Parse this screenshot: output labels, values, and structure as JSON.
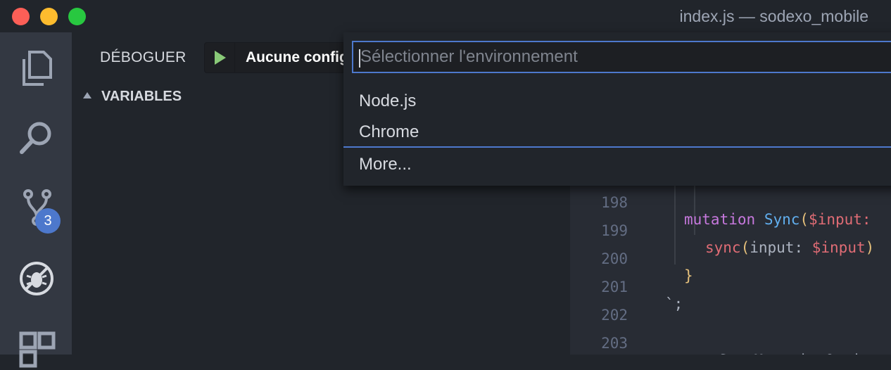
{
  "window": {
    "title": "index.js — sodexo_mobile"
  },
  "activity_bar": {
    "items": [
      {
        "icon": "files-icon"
      },
      {
        "icon": "search-icon"
      },
      {
        "icon": "source-control-icon",
        "badge": "3"
      },
      {
        "icon": "debug-icon"
      },
      {
        "icon": "extensions-icon"
      }
    ]
  },
  "debug": {
    "section_label": "DÉBOGUER",
    "config_name": "Aucune config",
    "variables_label": "VARIABLES"
  },
  "quick_pick": {
    "placeholder": "Sélectionner l'environnement",
    "options": [
      "Node.js",
      "Chrome"
    ],
    "more_label": "More..."
  },
  "editor": {
    "lines": [
      {
        "number": "198",
        "text": "mutation Sync($input:"
      },
      {
        "number": "199",
        "text": "sync(input: $input)"
      },
      {
        "number": "200",
        "text": "}"
      },
      {
        "number": "201",
        "text": "`;"
      },
      {
        "number": "202",
        "text": ""
      },
      {
        "number": "203",
        "text": "const SyncMutationOptio"
      }
    ]
  },
  "colors": {
    "accent": "#4d78cc",
    "play": "#89ca78",
    "badge": "#4d78cc"
  }
}
